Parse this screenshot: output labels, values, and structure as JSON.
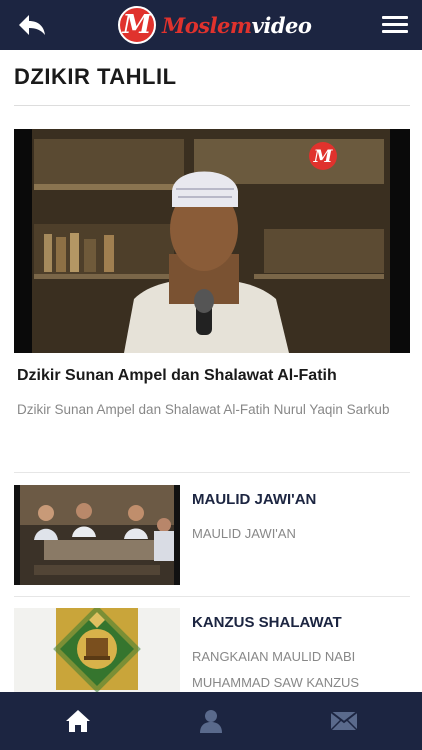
{
  "header": {
    "logo_letter": "M",
    "brand_part1": "Moslem",
    "brand_part2": "video",
    "back_icon": "back-arrow-icon",
    "menu_icon": "hamburger-menu-icon"
  },
  "page": {
    "title": "DZIKIR TAHLIL"
  },
  "featured": {
    "title": "Dzikir Sunan Ampel dan Shalawat Al-Fatih",
    "description": "Dzikir Sunan Ampel dan Shalawat Al-Fatih Nurul Yaqin Sarkub",
    "watermark_letter": "M"
  },
  "videos": [
    {
      "title": "MAULID JAWI'AN",
      "description": "MAULID JAWI'AN"
    },
    {
      "title": "KANZUS SHALAWAT",
      "description": "RANGKAIAN MAULID NABI MUHAMMAD SAW KANZUS"
    }
  ],
  "bottom_nav": [
    {
      "icon": "home-icon",
      "color": "#ffffff"
    },
    {
      "icon": "user-icon",
      "color": "#5a6a8c"
    },
    {
      "icon": "mail-icon",
      "color": "#5a6a8c"
    }
  ],
  "colors": {
    "bar": "#1c2541",
    "brand_red": "#e0322d",
    "muted_text": "#888888"
  }
}
